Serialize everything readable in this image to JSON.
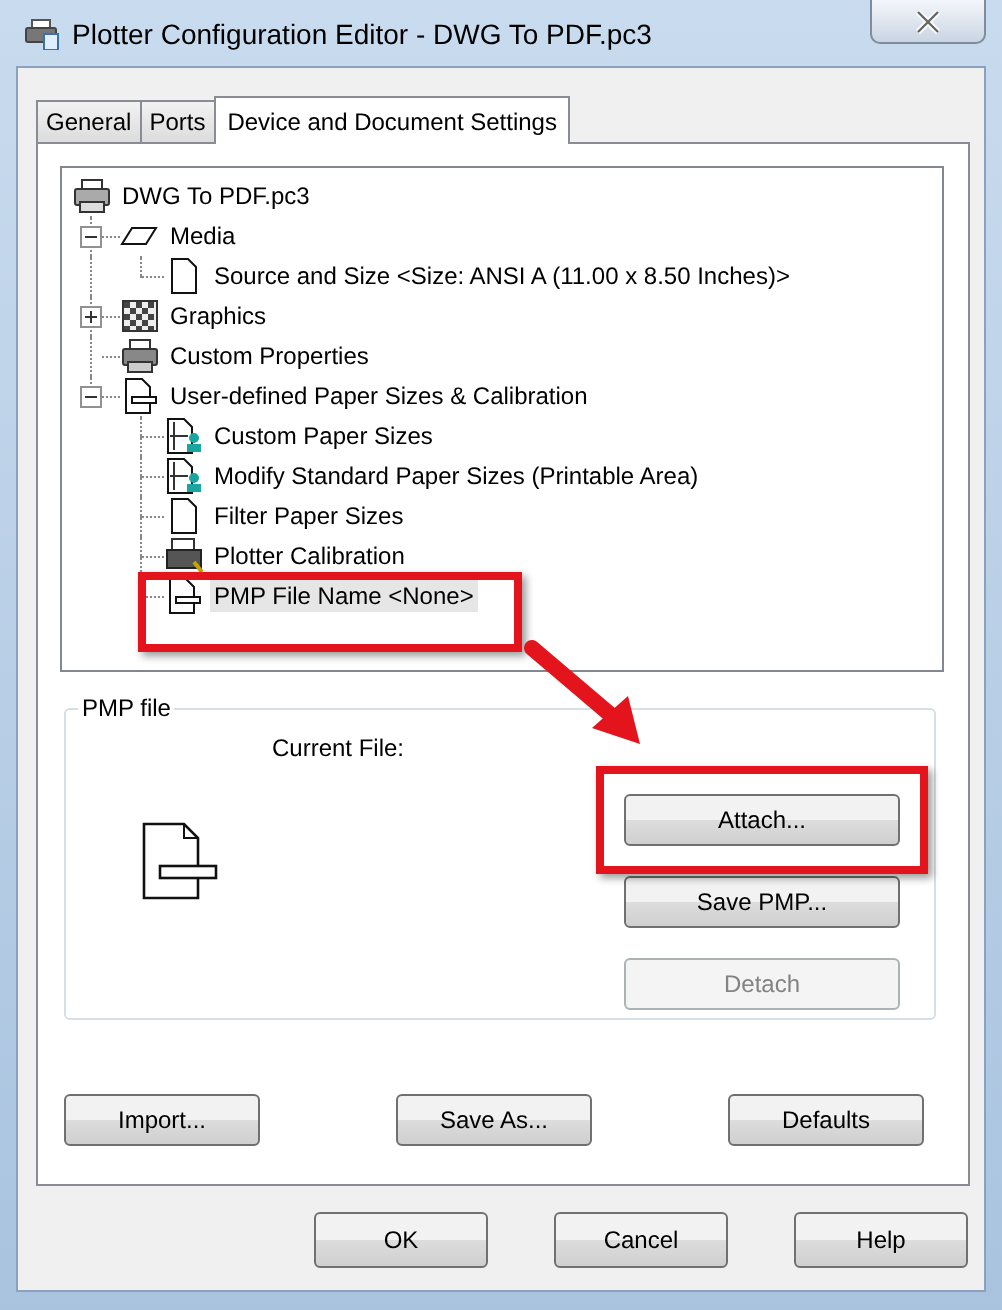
{
  "window": {
    "title": "Plotter Configuration Editor - DWG To PDF.pc3"
  },
  "tabs": [
    {
      "label": "General",
      "selected": false
    },
    {
      "label": "Ports",
      "selected": false
    },
    {
      "label": "Device and Document Settings",
      "selected": true
    }
  ],
  "tree": {
    "items": [
      {
        "label": "DWG To PDF.pc3",
        "kind": "device",
        "selected": false,
        "children": [
          {
            "label": "Media",
            "kind": "media",
            "selected": false,
            "expanded": true,
            "children": [
              {
                "label": "Source and Size <Size: ANSI A (11.00 x 8.50 Inches)>",
                "kind": "page",
                "selected": false
              }
            ]
          },
          {
            "label": "Graphics",
            "kind": "graphics",
            "selected": false,
            "expanded": false
          },
          {
            "label": "Custom Properties",
            "kind": "device",
            "selected": false
          },
          {
            "label": "User-defined Paper Sizes & Calibration",
            "kind": "paper",
            "selected": false,
            "expanded": true,
            "children": [
              {
                "label": "Custom Paper Sizes",
                "kind": "paper-size",
                "selected": false
              },
              {
                "label": "Modify Standard Paper Sizes (Printable Area)",
                "kind": "paper-size",
                "selected": false
              },
              {
                "label": "Filter Paper Sizes",
                "kind": "page",
                "selected": false
              },
              {
                "label": "Plotter Calibration",
                "kind": "plotter",
                "selected": false
              },
              {
                "label": "PMP File Name <None>",
                "kind": "paper",
                "selected": true
              }
            ]
          }
        ]
      }
    ]
  },
  "pmp_file": {
    "title": "PMP file",
    "current_file_label": "Current File:",
    "buttons": [
      {
        "label": "Attach...",
        "disabled": false
      },
      {
        "label": "Save PMP...",
        "disabled": false
      },
      {
        "label": "Detach",
        "disabled": true
      }
    ]
  },
  "panel_buttons": [
    "Import...",
    "Save As...",
    "Defaults"
  ],
  "dialog_buttons": [
    "OK",
    "Cancel",
    "Help"
  ]
}
